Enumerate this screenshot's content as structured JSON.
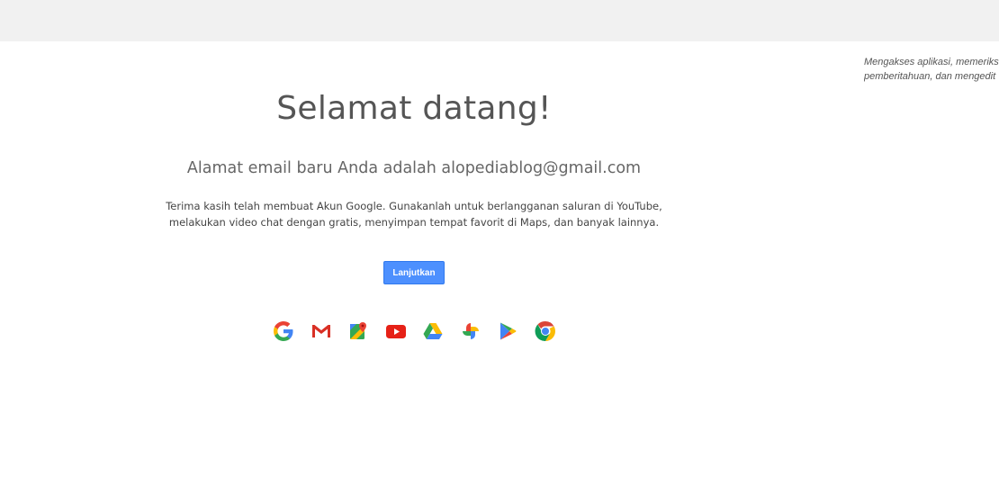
{
  "side_note": {
    "line1": "Mengakses aplikasi, memeriksa",
    "line2": "pemberitahuan, dan mengedit"
  },
  "welcome": {
    "title": "Selamat datang!",
    "subtitle": "Alamat email baru Anda adalah alopediablog@gmail.com",
    "desc_line1": "Terima kasih telah membuat Akun Google. Gunakanlah untuk berlangganan saluran di YouTube,",
    "desc_line2": "melakukan video chat dengan gratis, menyimpan tempat favorit di Maps, dan banyak lainnya.",
    "continue_label": "Lanjutkan"
  },
  "product_icons": [
    "google-icon",
    "gmail-icon",
    "maps-icon",
    "youtube-icon",
    "drive-icon",
    "photos-icon",
    "play-icon",
    "chrome-icon"
  ],
  "colors": {
    "accent": "#4d90fe",
    "google_blue": "#4285f4",
    "google_red": "#ea4335",
    "google_yellow": "#fbbc05",
    "google_green": "#34a853"
  }
}
